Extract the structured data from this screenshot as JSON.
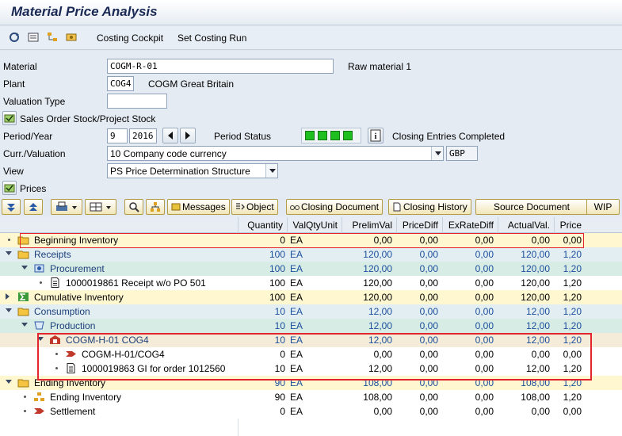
{
  "window": {
    "title": "Material Price Analysis"
  },
  "toolbar": {
    "costing_cockpit": "Costing Cockpit",
    "set_costing_run": "Set Costing Run"
  },
  "form": {
    "material_label": "Material",
    "material_value": "COGM-R-01",
    "material_desc": "Raw material 1",
    "plant_label": "Plant",
    "plant_value": "COG4",
    "plant_desc": "COGM Great Britain",
    "valuation_type_label": "Valuation Type",
    "valuation_type_value": "",
    "sales_order_stock": "Sales Order Stock/Project Stock",
    "period_label": "Period/Year",
    "period_value": "9",
    "year_value": "2016",
    "period_status_label": "Period Status",
    "period_status_text": "Closing Entries Completed",
    "currency_label": "Curr./Valuation",
    "currency_value": "10 Company code currency",
    "currency_code": "GBP",
    "view_label": "View",
    "view_value": "PS Price Determination Structure",
    "prices_label": "Prices"
  },
  "grid_toolbar": {
    "messages": "Messages",
    "object": "Object",
    "closing_document": "Closing Document",
    "closing_history": "Closing History",
    "source_document": "Source Document",
    "wip": "WIP"
  },
  "table": {
    "headers": [
      "Quantity",
      "ValQtyUnit",
      "PrelimVal",
      "PriceDiff",
      "ExRateDiff",
      "ActualVal.",
      "Price"
    ],
    "rows": [
      {
        "label": "Beginning Inventory",
        "q": "0",
        "u": "EA",
        "pv": "0,00",
        "pd": "0,00",
        "ed": "0,00",
        "av": "0,00",
        "p": "0,00"
      },
      {
        "label": "Receipts",
        "q": "100",
        "u": "EA",
        "pv": "120,00",
        "pd": "0,00",
        "ed": "0,00",
        "av": "120,00",
        "p": "1,20"
      },
      {
        "label": "Procurement",
        "q": "100",
        "u": "EA",
        "pv": "120,00",
        "pd": "0,00",
        "ed": "0,00",
        "av": "120,00",
        "p": "1,20"
      },
      {
        "label": "1000019861 Receipt w/o PO 501",
        "q": "100",
        "u": "EA",
        "pv": "120,00",
        "pd": "0,00",
        "ed": "0,00",
        "av": "120,00",
        "p": "1,20"
      },
      {
        "label": "Cumulative Inventory",
        "q": "100",
        "u": "EA",
        "pv": "120,00",
        "pd": "0,00",
        "ed": "0,00",
        "av": "120,00",
        "p": "1,20"
      },
      {
        "label": "Consumption",
        "q": "10",
        "u": "EA",
        "pv": "12,00",
        "pd": "0,00",
        "ed": "0,00",
        "av": "12,00",
        "p": "1,20"
      },
      {
        "label": "Production",
        "q": "10",
        "u": "EA",
        "pv": "12,00",
        "pd": "0,00",
        "ed": "0,00",
        "av": "12,00",
        "p": "1,20"
      },
      {
        "label": "COGM-H-01 COG4",
        "q": "10",
        "u": "EA",
        "pv": "12,00",
        "pd": "0,00",
        "ed": "0,00",
        "av": "12,00",
        "p": "1,20"
      },
      {
        "label": "COGM-H-01/COG4",
        "q": "0",
        "u": "EA",
        "pv": "0,00",
        "pd": "0,00",
        "ed": "0,00",
        "av": "0,00",
        "p": "0,00"
      },
      {
        "label": "1000019863 GI for order 1012560",
        "q": "10",
        "u": "EA",
        "pv": "12,00",
        "pd": "0,00",
        "ed": "0,00",
        "av": "12,00",
        "p": "1,20"
      },
      {
        "label": "Ending Inventory",
        "q": "90",
        "u": "EA",
        "pv": "108,00",
        "pd": "0,00",
        "ed": "0,00",
        "av": "108,00",
        "p": "1,20"
      },
      {
        "label": "Ending Inventory",
        "q": "90",
        "u": "EA",
        "pv": "108,00",
        "pd": "0,00",
        "ed": "0,00",
        "av": "108,00",
        "p": "1,20"
      },
      {
        "label": "Settlement",
        "q": "0",
        "u": "EA",
        "pv": "0,00",
        "pd": "0,00",
        "ed": "0,00",
        "av": "0,00",
        "p": "0,00"
      }
    ]
  },
  "colors": {
    "highlight_red": "#e3262e",
    "status_green": "#1fbf1f"
  }
}
